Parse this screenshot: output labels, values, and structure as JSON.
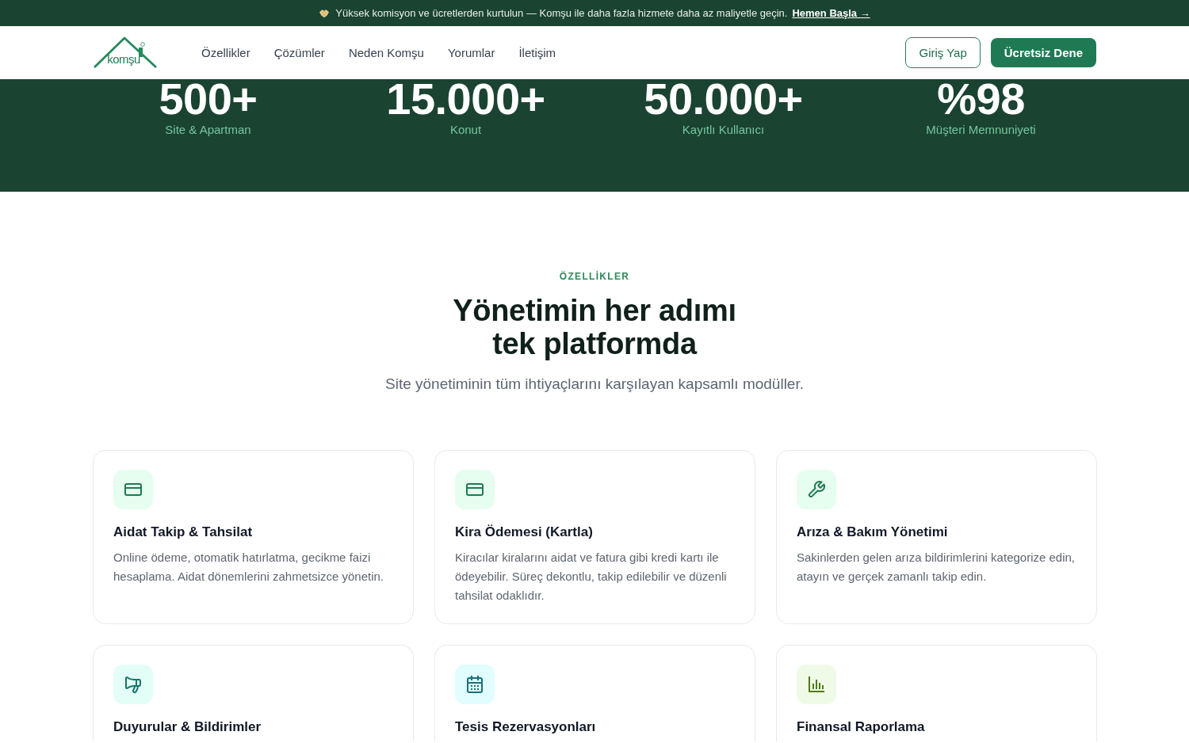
{
  "banner": {
    "text": "Yüksek komisyon ve ücretlerden kurtulun — Komşu ile daha fazla hizmete daha az maliyetle geçin.",
    "link": "Hemen Başla →"
  },
  "header": {
    "brand": "komşu",
    "nav": [
      "Özellikler",
      "Çözümler",
      "Neden Komşu",
      "Yorumlar",
      "İletişim"
    ],
    "login_button": "Giriş Yap",
    "cta_button": "Ücretsiz Dene"
  },
  "stats": [
    {
      "value": "500+",
      "label": "Site & Apartman"
    },
    {
      "value": "15.000+",
      "label": "Konut"
    },
    {
      "value": "50.000+",
      "label": "Kayıtlı Kullanıcı"
    },
    {
      "value": "%98",
      "label": "Müşteri Memnuniyeti"
    }
  ],
  "features": {
    "eyebrow": "ÖZELLİKLER",
    "title": "Yönetimin her adımı tek platformda",
    "subtitle": "Site yönetiminin tüm ihtiyaçlarını karşılayan kapsamlı modüller.",
    "cards": [
      {
        "kind": "payment",
        "color": "#1f7a54",
        "title": "Aidat Takip & Tahsilat",
        "description": "Online ödeme, otomatik hatırlatma, gecikme faizi hesaplama. Aidat dönemlerini zahmetsizce yönetin."
      },
      {
        "kind": "payment",
        "color": "#1f7a54",
        "title": "Kira Ödemesi (Kartla)",
        "description": "Kiracılar kiralarını aidat ve fatura gibi kredi kartı ile ödeyebilir. Süreç dekontlu, takip edilebilir ve düzenli tahsilat odaklıdır."
      },
      {
        "kind": "maintenance",
        "color": "#1f7a54",
        "title": "Arıza & Bakım Yönetimi",
        "description": "Sakinlerden gelen arıza bildirimlerini kategorize edin, atayın ve gerçek zamanlı takip edin."
      },
      {
        "kind": "announcement",
        "color": "#127766",
        "title": "Duyurular & Bildirimler"
      },
      {
        "kind": "reservation",
        "color": "#16717f",
        "title": "Tesis Rezervasyonları"
      },
      {
        "kind": "reporting",
        "color": "#4d7c0f",
        "title": "Finansal Raporlama"
      }
    ]
  }
}
